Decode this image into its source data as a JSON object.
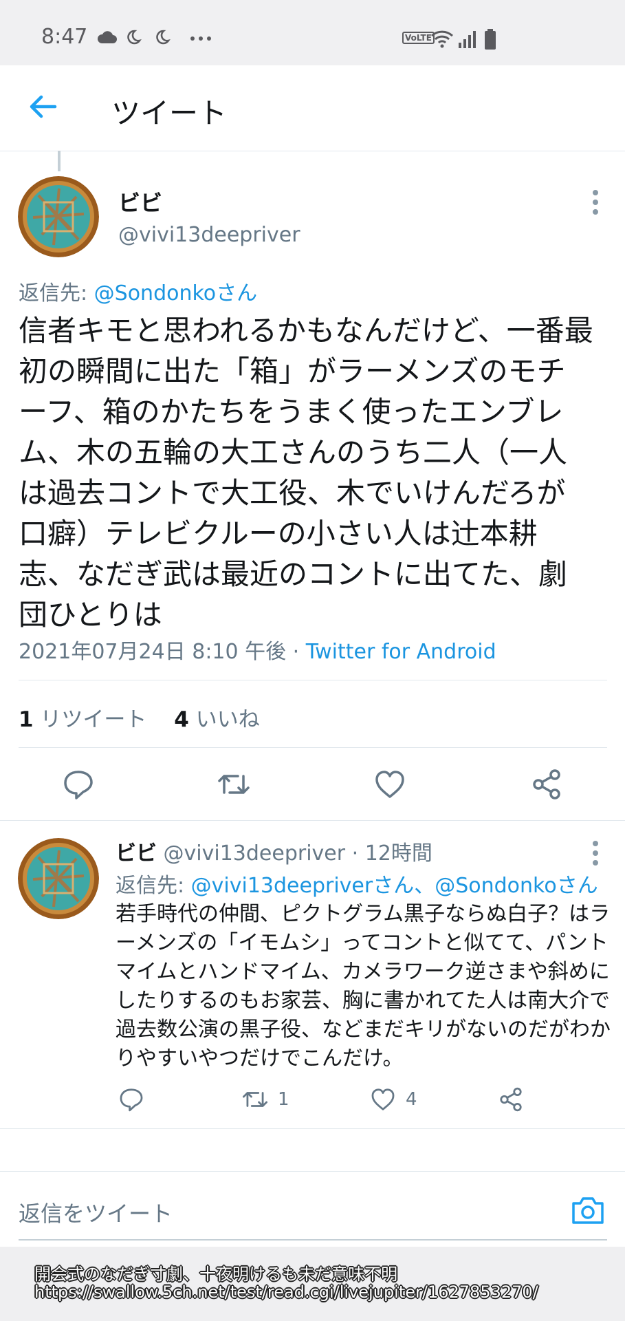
{
  "status_bar": {
    "time": "8:47",
    "network_badge": "VoLTE",
    "icons": [
      "cloud-icon",
      "moon-icon",
      "moon-icon",
      "more-dots-icon",
      "wifi-icon",
      "signal-icon",
      "battery-icon"
    ]
  },
  "header": {
    "title": "ツイート"
  },
  "tweet": {
    "display_name": "ビビ",
    "handle": "@vivi13deepriver",
    "replying_prefix": "返信先: ",
    "replying_to": "@Sondonkoさん",
    "text": "信者キモと思われるかもなんだけど、一番最初の瞬間に出た「箱」がラーメンズのモチーフ、箱のかたちをうまく使ったエンブレム、木の五輪の大工さんのうち二人（一人は過去コントで大工役、木でいけんだろが口癖）テレビクルーの小さい人は辻本耕志、なだぎ武は最近のコントに出てた、劇団ひとりは",
    "timestamp": "2021年07月24日 8:10 午後 · ",
    "source": "Twitter for Android",
    "retweet_count": "1",
    "retweet_label": " リツイート",
    "like_count": "4",
    "like_label": " いいね"
  },
  "reply": {
    "display_name": "ビビ",
    "handle": " @vivi13deepriver · 12時間",
    "replying_prefix": "返信先: ",
    "replying_to": "@vivi13deepriverさん、@Sondonkoさん",
    "text": "若手時代の仲間、ピクトグラム黒子ならぬ白子？はラーメンズの「イモムシ」ってコントと似てて、パントマイムとハンドマイム、カメラワーク逆さまや斜めにしたりするのもお家芸、胸に書かれてた人は南大介で過去数公演の黒子役、などまだキリがないのだがわかりやすいやつだけでこんだけ。",
    "retweet_count": "1",
    "like_count": "4"
  },
  "composer": {
    "placeholder": "返信をツイート"
  },
  "caption": {
    "line1": "開会式のなだぎ寸劇、十夜明けるも未だ意味不明",
    "line2": "https://swallow.5ch.net/test/read.cgi/livejupiter/1627853270/"
  },
  "colors": {
    "accent": "#1da1f2",
    "secondary_text": "#657786",
    "divider": "#e1e8ed"
  }
}
